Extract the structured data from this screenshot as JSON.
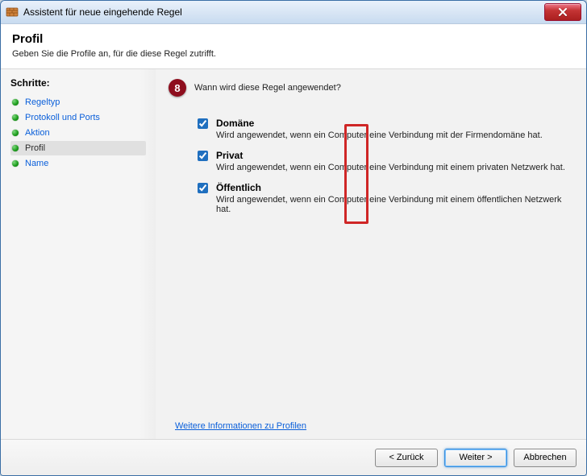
{
  "window": {
    "title": "Assistent für neue eingehende Regel"
  },
  "header": {
    "title": "Profil",
    "subtitle": "Geben Sie die Profile an, für die diese Regel zutrifft."
  },
  "sidebar": {
    "heading": "Schritte:",
    "steps": [
      {
        "label": "Regeltyp",
        "current": false
      },
      {
        "label": "Protokoll und Ports",
        "current": false
      },
      {
        "label": "Aktion",
        "current": false
      },
      {
        "label": "Profil",
        "current": true
      },
      {
        "label": "Name",
        "current": false
      }
    ]
  },
  "main": {
    "prompt": "Wann wird diese Regel angewendet?",
    "annotation_number": "8",
    "profiles": [
      {
        "id": "domain",
        "checked": true,
        "label": "Domäne",
        "desc": "Wird angewendet, wenn ein Computer eine Verbindung mit der Firmendomäne hat."
      },
      {
        "id": "private",
        "checked": true,
        "label": "Privat",
        "desc": "Wird angewendet, wenn ein Computer eine Verbindung mit einem privaten Netzwerk hat."
      },
      {
        "id": "public",
        "checked": true,
        "label": "Öffentlich",
        "desc": "Wird angewendet, wenn ein Computer eine Verbindung mit einem öffentlichen Netzwerk hat."
      }
    ],
    "learn_more": "Weitere Informationen zu Profilen"
  },
  "buttons": {
    "back": "< Zurück",
    "next": "Weiter >",
    "cancel": "Abbrechen"
  }
}
